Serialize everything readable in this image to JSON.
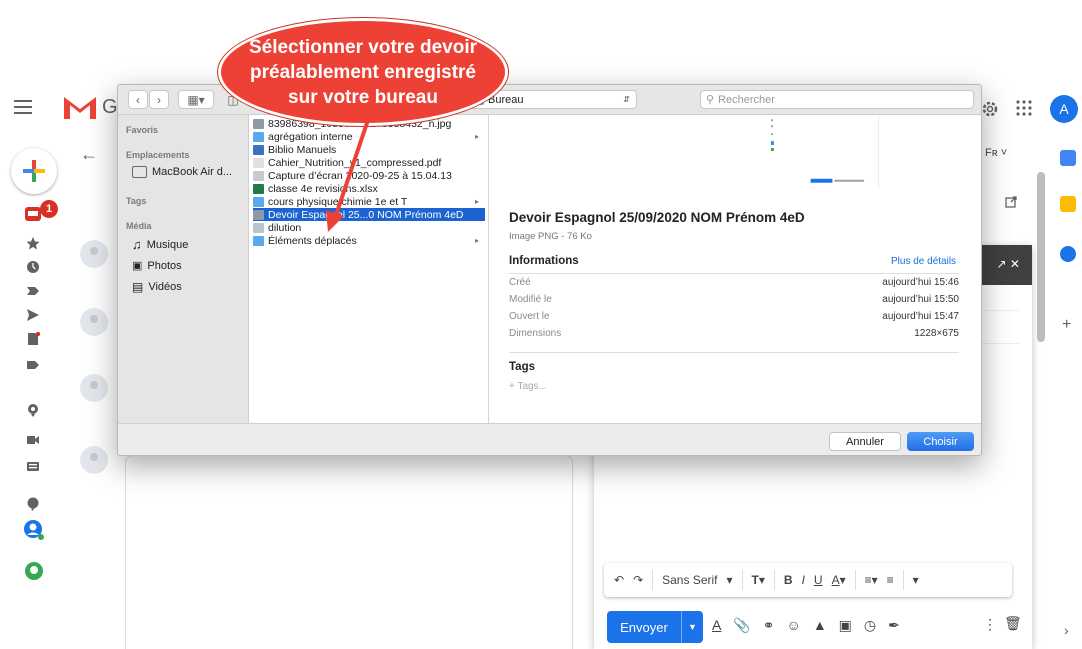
{
  "annotation": {
    "line1": "Sélectionner votre devoir",
    "line2": "préalablement enregistré",
    "line3": "sur votre bureau"
  },
  "gmail": {
    "logo_letter": "G",
    "avatar_letter": "A",
    "inbox_count": "1",
    "right_top_label": "Fʀ ˅",
    "send_label": "Envoyer",
    "font_label": "Sans Serif"
  },
  "dialog": {
    "location": "Bureau",
    "search_placeholder": "Rechercher",
    "sidebar": {
      "favorites": "Favoris",
      "locations": "Emplacements",
      "macbook": "MacBook Air d...",
      "tags": "Tags",
      "media": "Média",
      "music": "Musique",
      "photos": "Photos",
      "videos": "Vidéos"
    },
    "files": [
      {
        "name": "83986398_108567...5275538432_n.jpg",
        "icon": "image",
        "folder": false,
        "selected": false
      },
      {
        "name": "agrégation interne",
        "icon": "folder",
        "folder": true,
        "selected": false
      },
      {
        "name": "Biblio Manuels",
        "icon": "app",
        "folder": false,
        "selected": false
      },
      {
        "name": "Cahier_Nutrition_v1_compressed.pdf",
        "icon": "pdf",
        "folder": false,
        "selected": false
      },
      {
        "name": "Capture d’écran 2020-09-25 à 15.04.13",
        "icon": "screenshot",
        "folder": false,
        "selected": false
      },
      {
        "name": "classe 4e revisions.xlsx",
        "icon": "excel",
        "folder": false,
        "selected": false
      },
      {
        "name": "cours physique chimie 1e et T",
        "icon": "folder",
        "folder": true,
        "selected": false
      },
      {
        "name": "Devoir Espagnol  25...0 NOM Prénom 4eD",
        "icon": "image",
        "folder": false,
        "selected": true
      },
      {
        "name": "dilution",
        "icon": "doc",
        "folder": false,
        "selected": false
      },
      {
        "name": "Éléments déplacés",
        "icon": "folder",
        "folder": true,
        "selected": false
      }
    ],
    "preview": {
      "title": "Devoir Espagnol  25/09/2020 NOM Prénom 4eD",
      "subtitle": "Image PNG - 76 Ko",
      "info_heading": "Informations",
      "more_details": "Plus de détails",
      "rows": [
        {
          "k": "Créé",
          "v": "aujourd’hui 15:46"
        },
        {
          "k": "Modifié le",
          "v": "aujourd’hui 15:50"
        },
        {
          "k": "Ouvert le",
          "v": "aujourd’hui 15:47"
        },
        {
          "k": "Dimensions",
          "v": "1228×675"
        }
      ],
      "tags_heading": "Tags",
      "tags_placeholder": "+ Tags..."
    },
    "cancel": "Annuler",
    "choose": "Choisir"
  },
  "colors": {
    "accent": "#1a73e8",
    "callout": "#ee4136",
    "selection": "#1b64d1"
  }
}
